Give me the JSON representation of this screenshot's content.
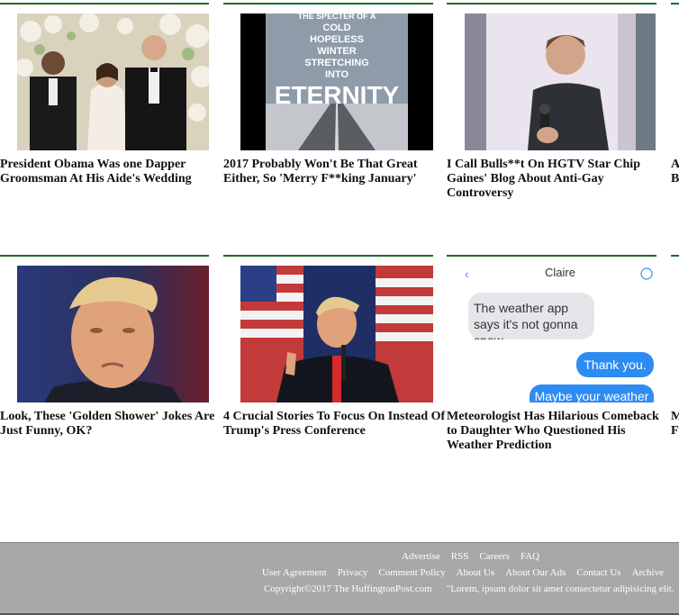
{
  "articles": [
    {
      "title": "President Obama Was one Dapper Groomsman At His Aide's Wedding",
      "image": "wedding-photo"
    },
    {
      "title": "2017 Probably Won't Be That Great Either, So 'Merry F**king January'",
      "image": "winter-road-poster",
      "poster_lines": [
        "THE SPECTER OF A",
        "COLD",
        "HOPELESS",
        "WINTER",
        "STRETCHING",
        "INTO",
        "ETERNITY"
      ]
    },
    {
      "title": "I Call Bulls**t On HGTV Star Chip Gaines' Blog About Anti-Gay Controversy",
      "image": "man-with-microphone"
    },
    {
      "title": "A",
      "title2": "B",
      "image": "cut-off"
    },
    {
      "title": "Look, These 'Golden Shower' Jokes Are Just Funny, OK?",
      "image": "trump-portrait"
    },
    {
      "title": "4 Crucial Stories To Focus On Instead Of Trump's Press Conference",
      "image": "trump-thumbs-up"
    },
    {
      "title": "Meteorologist Has Hilarious Comeback to Daughter Who Questioned His Weather Prediction",
      "image": "text-message-screenshot",
      "chat": {
        "contact": "Claire",
        "received": "The weather app says it's not gonna snow",
        "sent1": "Thank you.",
        "sent2": "Maybe your weather"
      }
    },
    {
      "title": "M",
      "title2": "F",
      "image": "cut-off"
    }
  ],
  "footer": {
    "links_row1": [
      "Advertise",
      "RSS",
      "Careers",
      "FAQ"
    ],
    "links_row2": [
      "User Agreement",
      "Privacy",
      "Comment Policy",
      "About Us",
      "About Our Ads",
      "Contact Us",
      "Archive"
    ],
    "copyright": "Copyright©2017 The HuffingtonPost.com",
    "tagline": "\"Lorem, ipsum dolor sit amet consectetur adipisicing elit."
  }
}
